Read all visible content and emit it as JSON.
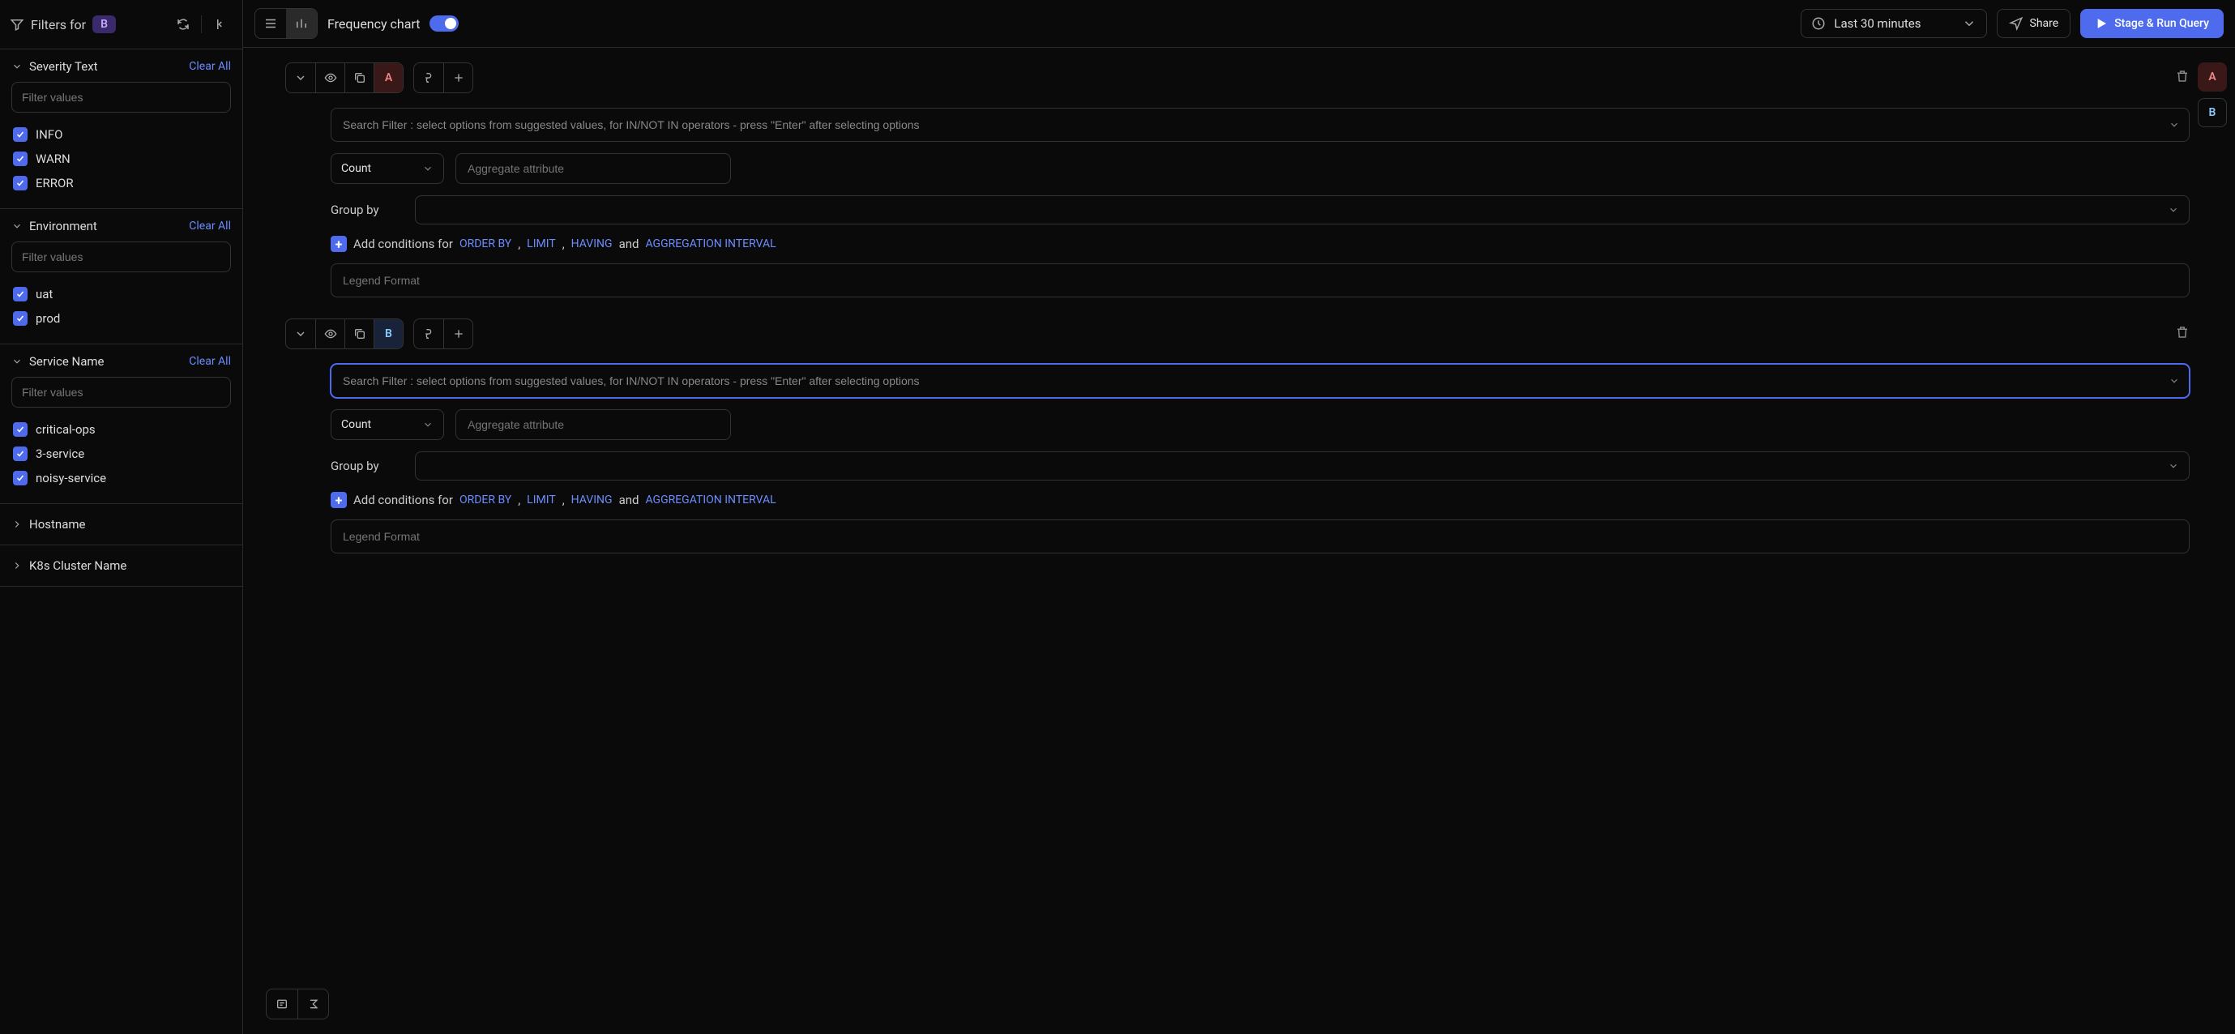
{
  "sidebar": {
    "filters_for": "Filters for",
    "badge": "B",
    "facets": [
      {
        "title": "Severity Text",
        "clear": "Clear All",
        "filter_placeholder": "Filter values",
        "items": [
          "INFO",
          "WARN",
          "ERROR"
        ]
      },
      {
        "title": "Environment",
        "clear": "Clear All",
        "filter_placeholder": "Filter values",
        "items": [
          "uat",
          "prod"
        ]
      },
      {
        "title": "Service Name",
        "clear": "Clear All",
        "filter_placeholder": "Filter values",
        "items": [
          "critical-ops",
          "3-service",
          "noisy-service"
        ]
      }
    ],
    "collapsed": [
      "Hostname",
      "K8s Cluster Name"
    ]
  },
  "topbar": {
    "freq_label": "Frequency chart",
    "time_label": "Last 30 minutes",
    "share": "Share",
    "run": "Stage & Run Query"
  },
  "queries": [
    {
      "letter": "A",
      "search_placeholder": "Search Filter : select options from suggested values, for IN/NOT IN operators - press \"Enter\" after selecting options",
      "count": "Count",
      "agg_placeholder": "Aggregate attribute",
      "group_by_label": "Group by",
      "add_cond_prefix": "Add conditions for",
      "order_by": "ORDER BY",
      "limit": "LIMIT",
      "having": "HAVING",
      "and": "and",
      "agg_interval": "AGGREGATION INTERVAL",
      "legend_placeholder": "Legend Format"
    },
    {
      "letter": "B",
      "focused": true,
      "search_placeholder": "Search Filter : select options from suggested values, for IN/NOT IN operators - press \"Enter\" after selecting options",
      "count": "Count",
      "agg_placeholder": "Aggregate attribute",
      "group_by_label": "Group by",
      "add_cond_prefix": "Add conditions for",
      "order_by": "ORDER BY",
      "limit": "LIMIT",
      "having": "HAVING",
      "and": "and",
      "agg_interval": "AGGREGATION INTERVAL",
      "legend_placeholder": "Legend Format"
    }
  ],
  "right_rail": [
    "A",
    "B"
  ]
}
